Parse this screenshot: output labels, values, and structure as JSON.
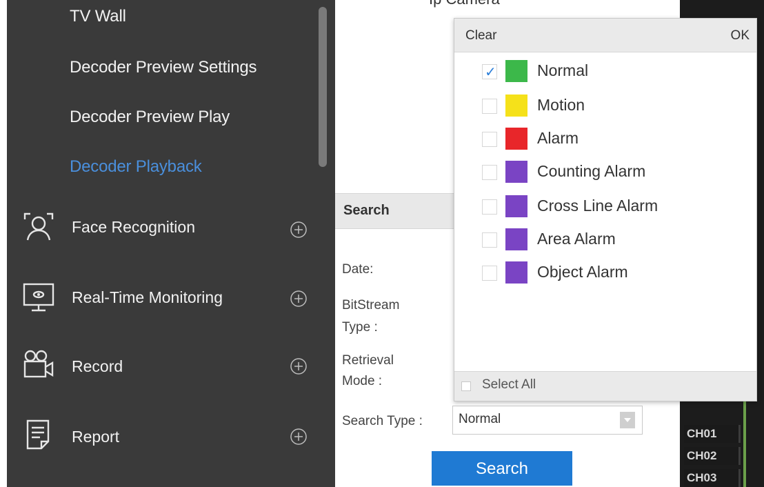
{
  "sidebar": {
    "sub_items": [
      {
        "label": "TV Wall",
        "active": false
      },
      {
        "label": "Decoder Preview Settings",
        "active": false
      },
      {
        "label": "Decoder Preview Play",
        "active": false
      },
      {
        "label": "Decoder Playback",
        "active": true
      }
    ],
    "nav_items": [
      {
        "label": "Face Recognition",
        "icon": "face-recognition-icon"
      },
      {
        "label": "Real-Time Monitoring",
        "icon": "monitor-icon"
      },
      {
        "label": "Record",
        "icon": "video-camera-icon"
      },
      {
        "label": "Report",
        "icon": "report-document-icon"
      }
    ],
    "active_color": "#4a8fdc",
    "background": "#3a3a3a"
  },
  "center": {
    "top_text": "Ip Camera",
    "search_title": "Search",
    "labels": {
      "date": "Date:",
      "bitstream_1": "BitStream",
      "bitstream_2": "Type :",
      "retrieval_1": "Retrieval",
      "retrieval_2": "Mode :",
      "search_type": "Search Type :"
    },
    "search_type_value": "Normal",
    "search_button": "Search",
    "button_color": "#1f7ad3"
  },
  "popup": {
    "clear": "Clear",
    "ok": "OK",
    "select_all": "Select All",
    "options": [
      {
        "label": "Normal",
        "color": "#3cb84a",
        "checked": true
      },
      {
        "label": "Motion",
        "color": "#f5e11a",
        "checked": false
      },
      {
        "label": "Alarm",
        "color": "#e8262a",
        "checked": false
      },
      {
        "label": "Counting Alarm",
        "color": "#7a44c4",
        "checked": false
      },
      {
        "label": "Cross Line Alarm",
        "color": "#7a44c4",
        "checked": false
      },
      {
        "label": "Area Alarm",
        "color": "#7a44c4",
        "checked": false
      },
      {
        "label": "Object Alarm",
        "color": "#7a44c4",
        "checked": false
      }
    ]
  },
  "channels": [
    "CH01",
    "CH02",
    "CH03"
  ]
}
